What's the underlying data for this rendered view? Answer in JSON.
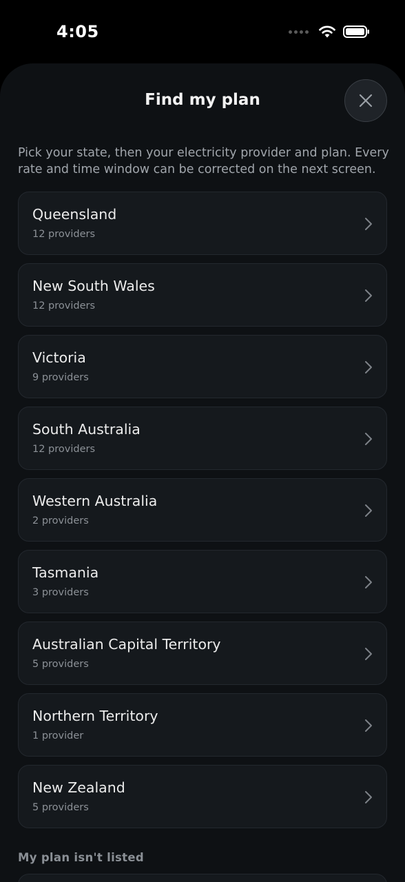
{
  "status_bar": {
    "time": "4:05"
  },
  "sheet": {
    "title": "Find my plan",
    "intro": "Pick your state, then your electricity provider and plan. Every rate and time window can be corrected on the next screen.",
    "states": [
      {
        "name": "Queensland",
        "count": "12 providers"
      },
      {
        "name": "New South Wales",
        "count": "12 providers"
      },
      {
        "name": "Victoria",
        "count": "9 providers"
      },
      {
        "name": "South Australia",
        "count": "12 providers"
      },
      {
        "name": "Western Australia",
        "count": "2 providers"
      },
      {
        "name": "Tasmania",
        "count": "3 providers"
      },
      {
        "name": "Australian Capital Territory",
        "count": "5 providers"
      },
      {
        "name": "Northern Territory",
        "count": "1 provider"
      },
      {
        "name": "New Zealand",
        "count": "5 providers"
      }
    ],
    "unlisted_label": "My plan isn't listed"
  },
  "icons": {
    "close": "close-icon",
    "chevron": "chevron-right-icon",
    "wifi": "wifi-icon",
    "battery": "battery-icon",
    "signal": "signal-icon"
  }
}
